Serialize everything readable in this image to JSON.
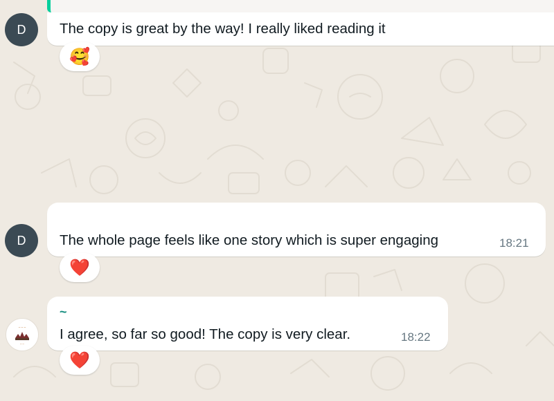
{
  "colors": {
    "wallpaper": "#efeae2",
    "bubble": "#ffffff",
    "avatar": "#3b4a54",
    "accent": "#06cf9c",
    "timestamp": "#667781"
  },
  "messages": [
    {
      "avatar_initial": "D",
      "text": "The copy is great by the way! I really liked reading it",
      "time": "",
      "reaction": {
        "emoji": "🥰",
        "icon": "smiling-face-with-hearts-icon"
      }
    },
    {
      "avatar_initial": "D",
      "text": "The whole page feels like one story which is super engaging",
      "time": "18:21",
      "reaction": {
        "emoji": "❤️",
        "icon": "red-heart-icon"
      }
    },
    {
      "avatar_logo": "brand-logo-avatar",
      "sender": "~",
      "text": "I agree, so far so good! The copy is very clear.",
      "time": "18:22",
      "reaction": {
        "emoji": "❤️",
        "icon": "red-heart-icon"
      }
    }
  ]
}
